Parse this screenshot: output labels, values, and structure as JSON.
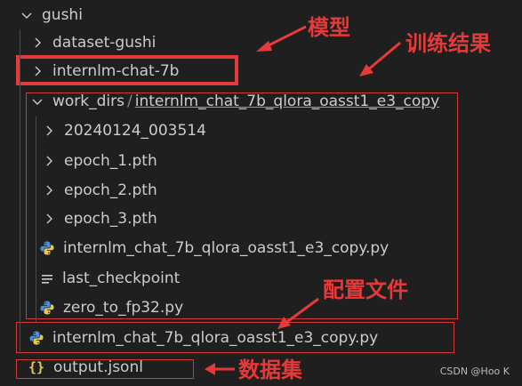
{
  "explorer": {
    "root": {
      "label": "gushi",
      "expanded": true
    },
    "items": [
      {
        "label": "dataset-gushi",
        "type": "folder",
        "expanded": false
      },
      {
        "label": "internlm-chat-7b",
        "type": "folder",
        "expanded": false
      },
      {
        "label": "work_dirs",
        "sub": "internlm_chat_7b_qlora_oasst1_e3_copy",
        "type": "folder",
        "expanded": true
      },
      {
        "label": "20240124_003514",
        "type": "folder",
        "expanded": false
      },
      {
        "label": "epoch_1.pth",
        "type": "folder",
        "expanded": false
      },
      {
        "label": "epoch_2.pth",
        "type": "folder",
        "expanded": false
      },
      {
        "label": "epoch_3.pth",
        "type": "folder",
        "expanded": false
      },
      {
        "label": "internlm_chat_7b_qlora_oasst1_e3_copy.py",
        "type": "python"
      },
      {
        "label": "last_checkpoint",
        "type": "text"
      },
      {
        "label": "zero_to_fp32.py",
        "type": "python"
      },
      {
        "label": "internlm_chat_7b_qlora_oasst1_e3_copy.py",
        "type": "python"
      },
      {
        "label": "output.jsonl",
        "type": "json"
      }
    ],
    "json_icon_glyph": "{}"
  },
  "annotations": {
    "model": "模型",
    "train_result": "训练结果",
    "config_file": "配置文件",
    "dataset": "数据集",
    "color": "#e63a3a"
  },
  "watermark": "CSDN @Hoo K"
}
